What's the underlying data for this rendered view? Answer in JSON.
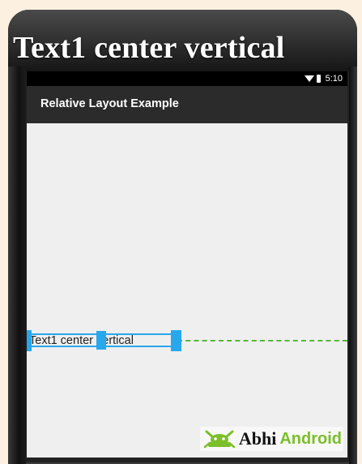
{
  "headline": "Text1 center vertical",
  "status_bar": {
    "time": "5:10",
    "icons": [
      "wifi-icon",
      "battery-icon"
    ]
  },
  "action_bar": {
    "title": "Relative Layout Example"
  },
  "textview": {
    "text": "Text1 center vertical",
    "selection_color": "#27a7ec",
    "guide_color": "#55b83a"
  },
  "watermark": {
    "logo_icon": "android-robot-icon",
    "part1": "Abhi",
    "part2": "Android",
    "accent": "#7bbf2a"
  }
}
